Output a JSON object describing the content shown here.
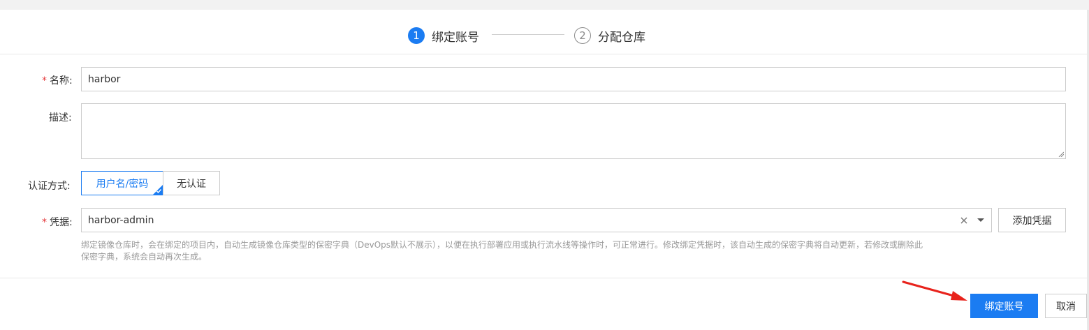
{
  "steps": [
    {
      "number": "1",
      "label": "绑定账号",
      "active": true
    },
    {
      "number": "2",
      "label": "分配仓库",
      "active": false
    }
  ],
  "form": {
    "name": {
      "label": "名称:",
      "value": "harbor",
      "required": true
    },
    "description": {
      "label": "描述:",
      "value": ""
    },
    "auth": {
      "label": "认证方式:",
      "options": [
        "用户名/密码",
        "无认证"
      ],
      "selected": "用户名/密码"
    },
    "credential": {
      "label": "凭据:",
      "value": "harbor-admin",
      "required": true,
      "add_button": "添加凭据",
      "help_line1": "绑定镜像仓库时，会在绑定的项目内，自动生成镜像仓库类型的保密字典（DevOps默认不展示），以便在执行部署应用或执行流水线等操作时，可正常进行。修改绑定凭据时，该自动生成的保密字典将自动更新，若修改或删除此",
      "help_line2": "保密字典，系统会自动再次生成。"
    }
  },
  "footer": {
    "confirm_label": "绑定账号",
    "cancel_label": "取消"
  },
  "colors": {
    "accent": "#1b7cf2",
    "required": "#e4393c",
    "annotation_arrow": "#e8231c"
  }
}
